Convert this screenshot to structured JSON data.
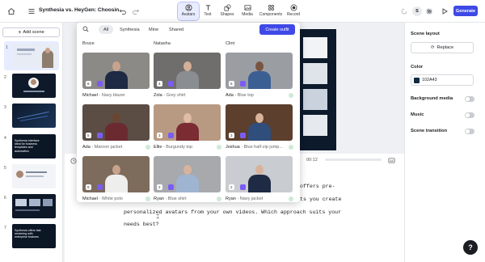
{
  "topbar": {
    "doc_title": "Synthesia vs. HeyGen: Choosin...",
    "tools": [
      "Avatars",
      "Text",
      "Shapes",
      "Media",
      "Components",
      "Record"
    ],
    "user_initial": "S",
    "generate_label": "Generate"
  },
  "scenes": {
    "add_label": "Add scene",
    "items": [
      {
        "num": "1",
        "caption": ""
      },
      {
        "num": "2",
        "caption": ""
      },
      {
        "num": "3",
        "caption": ""
      },
      {
        "num": "4",
        "caption": "Synthesia interface ideal for business templates and automation"
      },
      {
        "num": "5",
        "caption": ""
      },
      {
        "num": "6",
        "caption": ""
      },
      {
        "num": "7",
        "caption": "Synthesia offers fast rendering with enterprise features"
      }
    ]
  },
  "avatars_panel": {
    "filters": [
      "All",
      "Synthesia",
      "Mine",
      "Shared"
    ],
    "create_label": "Create outfit",
    "columns": [
      "Bruce",
      "Natasha",
      "Clint"
    ],
    "cards": [
      {
        "name": "Michael",
        "outfit": "Navy blazer",
        "count": "8"
      },
      {
        "name": "Zola",
        "outfit": "Grey shirt",
        "count": "4"
      },
      {
        "name": "Ada",
        "outfit": "Blue top",
        "count": "5"
      },
      {
        "name": "Ada",
        "outfit": "Maroon jacket",
        "count": "5"
      },
      {
        "name": "Ellie",
        "outfit": "Burgundy top",
        "count": "3"
      },
      {
        "name": "Joshua",
        "outfit": "Blue half-zip jump...",
        "count": "3"
      },
      {
        "name": "Michael",
        "outfit": "White polo",
        "count": "8"
      },
      {
        "name": "Ryan",
        "outfit": "Blue shirt",
        "count": "2"
      },
      {
        "name": "Ryan",
        "outfit": "Navy jacket",
        "count": "2"
      }
    ]
  },
  "timeline": {
    "time": "00:12"
  },
  "script": {
    "lines": [
      "offers pre-",
      "ts you create",
      "personalized avatars from your own videos. Which approach suits your",
      "needs best?"
    ]
  },
  "right_panel": {
    "scene_layout_label": "Scene layout",
    "replace_label": "Replace",
    "color_label": "Color",
    "color_value": "102A43",
    "background_media_label": "Background media",
    "music_label": "Music",
    "scene_transition_label": "Scene transition",
    "help_label": "?"
  },
  "colors": {
    "accent": "#3e49e6",
    "swatch": "#102A43"
  }
}
